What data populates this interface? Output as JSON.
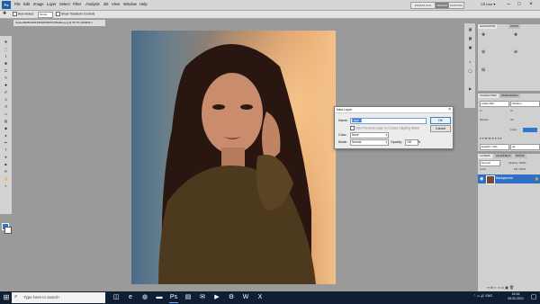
{
  "menu": {
    "logo": "Ps",
    "items": [
      "File",
      "Edit",
      "Image",
      "Layer",
      "Select",
      "Filter",
      "Analysis",
      "3D",
      "View",
      "Window",
      "Help"
    ],
    "workspace": [
      "ESSENTIALS",
      "DESIGN",
      "PAINTING"
    ],
    "cs_live": "CS Live ▾"
  },
  "options": {
    "auto_select_label": "Auto-Select:",
    "auto_select_value": "Group",
    "transform_label": "Show Transform Controls"
  },
  "document": {
    "tab_title": "ChameBeBha001405465058074d5a9be.jpg @ 66.7% (RGB/8) ×",
    "status": "Doc: 4.37M/4.37M"
  },
  "panels": {
    "nav_tabs": [
      "NAVIGATOR",
      "HISTO"
    ],
    "character_tabs": [
      "CHARACTER",
      "PARAGRAPH"
    ],
    "font_family": "Arabic Bld",
    "font_style": "Medium",
    "tracking_label": "Metrics",
    "language": "English: USA",
    "layers_tabs": [
      "LAYERS",
      "CHANNELS",
      "PATHS"
    ],
    "blend_mode": "Normal",
    "opacity_label": "Opacity: 100%",
    "lock_label": "Lock:",
    "fill_label": "Fill: 100%",
    "layer_name": "Background",
    "color_label": "Color:"
  },
  "dialog": {
    "title": "New Layer",
    "name_label": "Name:",
    "name_value": "Layer 1",
    "clip_label": "Use Previous Layer to Create Clipping Mask",
    "color_label": "Color:",
    "color_value": "None",
    "mode_label": "Mode:",
    "mode_value": "Normal",
    "opacity_label": "Opacity:",
    "opacity_value": "100",
    "opacity_unit": "%",
    "ok": "OK",
    "cancel": "Cancel"
  },
  "taskbar": {
    "search_placeholder": "Type here to search",
    "tray": "ENG",
    "time": "15:15",
    "date": "29-02-2021"
  },
  "colors": {
    "accent": "#3b78d8",
    "layer_selected": "#2f6fc5",
    "foreground_swatch": "#2c78d4",
    "taskbar": "#0e1f34"
  }
}
